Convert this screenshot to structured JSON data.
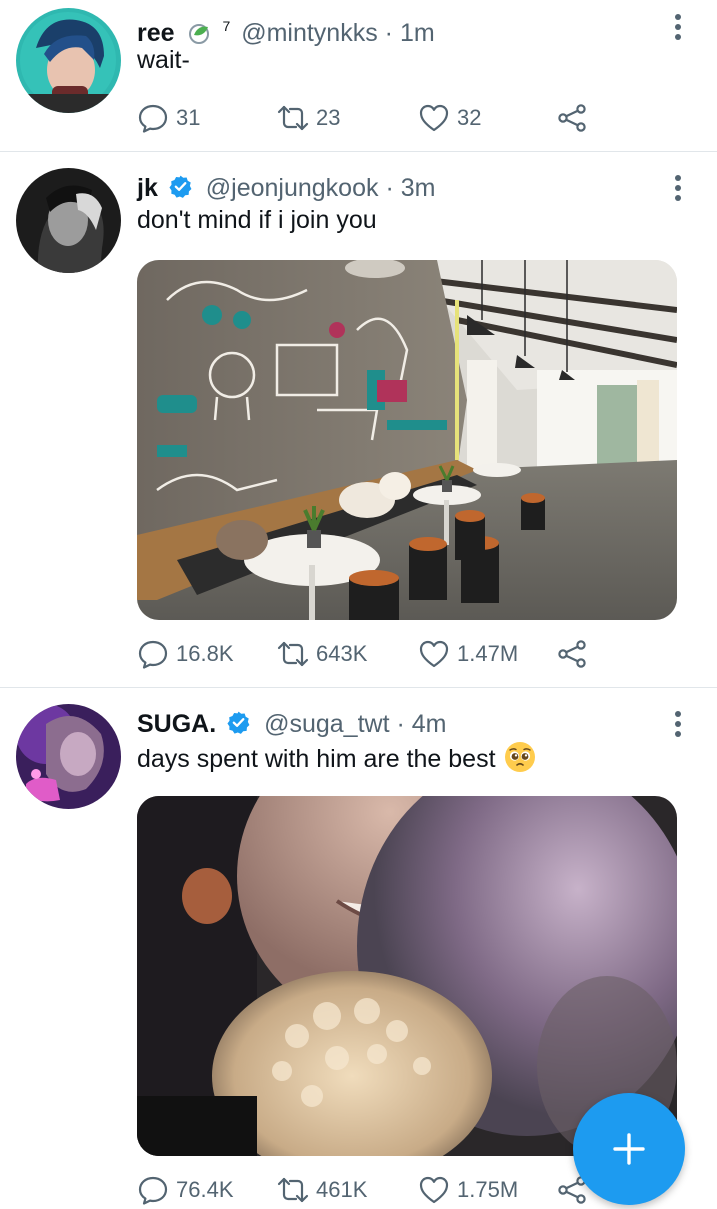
{
  "tweets": [
    {
      "name": "ree",
      "badge": "7",
      "handle": "@mintynkks",
      "dot": "·",
      "time": "1m",
      "text": "wait-",
      "reply_count": "31",
      "retweet_count": "23",
      "like_count": "32"
    },
    {
      "name": "jk",
      "handle": "@jeonjungkook",
      "dot": "·",
      "time": "3m",
      "text": "don't mind if i join you",
      "reply_count": "16.8K",
      "retweet_count": "643K",
      "like_count": "1.47M"
    },
    {
      "name": "SUGA.",
      "handle": "@suga_twt",
      "dot": "·",
      "time": "4m",
      "text": "days spent with him are the best",
      "reply_count": "76.4K",
      "retweet_count": "461K",
      "like_count": "1.75M"
    }
  ],
  "icons": {
    "reply": "reply-icon",
    "retweet": "retweet-icon",
    "like": "like-icon",
    "share": "share-icon",
    "more": "more-options-icon",
    "verified": "verified-badge-icon",
    "compose": "compose-plus-icon"
  },
  "colors": {
    "accent": "#1d9bf0",
    "muted": "#536471",
    "text": "#0f1419"
  }
}
